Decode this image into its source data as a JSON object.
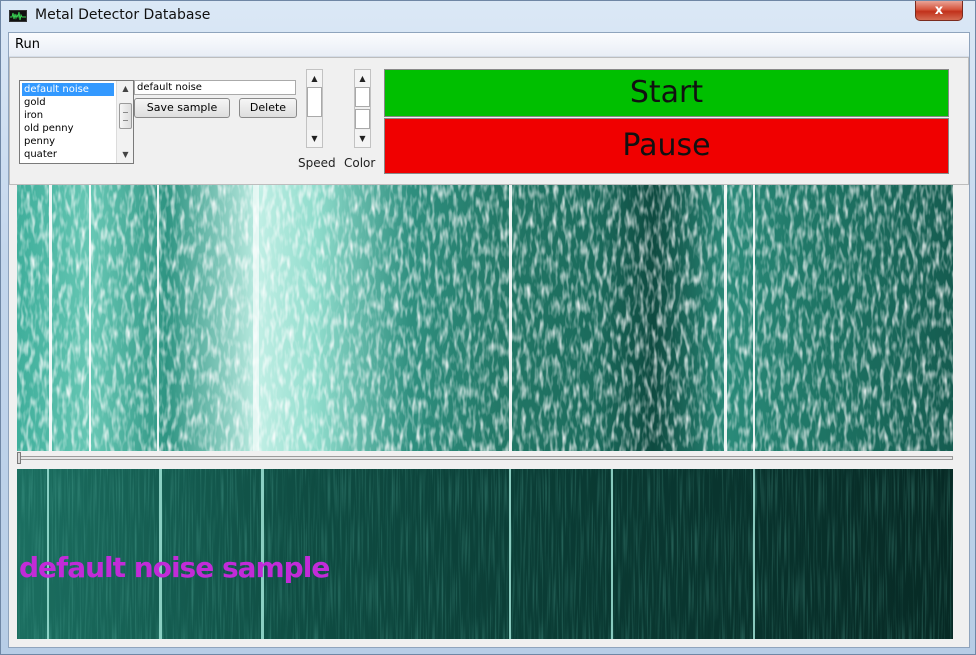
{
  "window": {
    "title": "Metal Detector Database",
    "close_label": "x"
  },
  "menu": {
    "items": [
      {
        "label": "Run"
      }
    ]
  },
  "samples": {
    "items": [
      {
        "label": "default noise",
        "selected": true
      },
      {
        "label": "gold",
        "selected": false
      },
      {
        "label": "iron",
        "selected": false
      },
      {
        "label": "old penny",
        "selected": false
      },
      {
        "label": "penny",
        "selected": false
      },
      {
        "label": "quater",
        "selected": false
      }
    ],
    "name_value": "default noise",
    "save_label": "Save sample",
    "delete_label": "Delete"
  },
  "controls": {
    "speed_label": "Speed",
    "color_label": "Color",
    "start_label": "Start",
    "pause_label": "Pause"
  },
  "colors": {
    "start": "#00bf00",
    "pause": "#f00000",
    "waterfall_bright": "#ffffff",
    "waterfall_mid": "#2e9c8a",
    "waterfall_dark": "#063028",
    "overlay_text": "#c22bd8"
  },
  "sample_view": {
    "overlay": "default noise sample"
  },
  "icons": {
    "app": "waveform-icon",
    "close": "close-icon",
    "scroll_up": "arrow-up-icon",
    "scroll_down": "arrow-down-icon"
  }
}
